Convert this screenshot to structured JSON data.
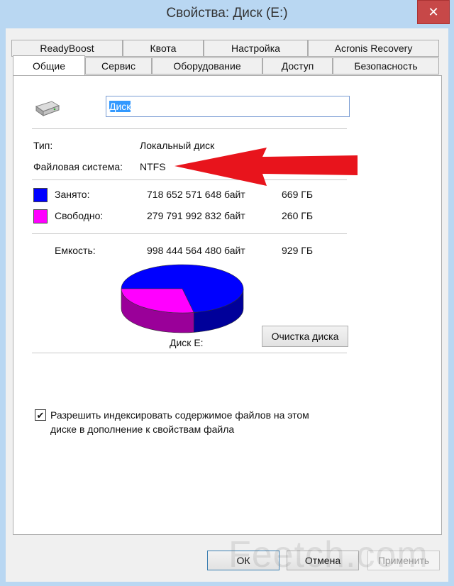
{
  "window": {
    "title": "Свойства: Диск (E:)"
  },
  "tabs_row1": [
    "ReadyBoost",
    "Квота",
    "Настройка",
    "Acronis Recovery"
  ],
  "tabs_row2": [
    "Общие",
    "Сервис",
    "Оборудование",
    "Доступ",
    "Безопасность"
  ],
  "active_tab": "Общие",
  "general": {
    "drive_name": "Диск",
    "type_label": "Тип:",
    "type_value": "Локальный диск",
    "fs_label": "Файловая система:",
    "fs_value": "NTFS",
    "used_label": "Занято:",
    "used_bytes": "718 652 571 648 байт",
    "used_size": "669 ГБ",
    "free_label": "Свободно:",
    "free_bytes": "279 791 992 832 байт",
    "free_size": "260 ГБ",
    "capacity_label": "Емкость:",
    "capacity_bytes": "998 444 564 480 байт",
    "capacity_size": "929 ГБ",
    "drive_caption": "Диск E:",
    "cleanup_button": "Очистка диска",
    "index_checkbox_line1": "Разрешить индексировать содержимое файлов на этом",
    "index_checkbox_line2": "диске в дополнение к свойствам файла",
    "index_checked": true
  },
  "pie": {
    "used_fraction": 0.7198,
    "used_color": "#0000ff",
    "free_color": "#ff00ff",
    "used_side_color": "#00009a",
    "free_side_color": "#9a0099"
  },
  "annotation": {
    "arrow_color": "#e8141c"
  },
  "buttons": {
    "ok": "ОК",
    "cancel": "Отмена",
    "apply": "Применить"
  },
  "watermark": "Feetch.com"
}
